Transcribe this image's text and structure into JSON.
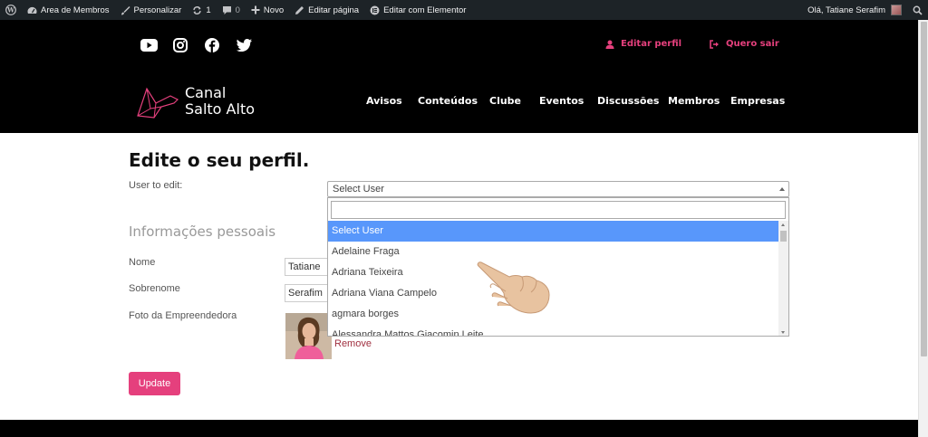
{
  "adminbar": {
    "site_name": "Area de Membros",
    "customize": "Personalizar",
    "updates_count": "1",
    "comments_count": "0",
    "new_label": "Novo",
    "edit_page": "Editar página",
    "edit_elementor": "Editar com Elementor",
    "greeting": "Olá, Tatiane Serafim"
  },
  "header": {
    "social_icons": [
      "youtube-icon",
      "instagram-icon",
      "facebook-icon",
      "twitter-icon"
    ],
    "edit_profile_link": "Editar perfil",
    "logout_link": "Quero sair",
    "logo_line1": "Canal",
    "logo_line2": "Salto Alto",
    "nav": [
      "Avisos",
      "Conteúdos",
      "Clube",
      "Eventos",
      "Discussões",
      "Membros",
      "Empresas"
    ],
    "accent_color": "#e5407d"
  },
  "main": {
    "page_title": "Edite o seu perfil.",
    "user_to_edit_label": "User to edit:",
    "select": {
      "value": "Select User",
      "options": [
        "Select User",
        "Adelaine Fraga",
        "Adriana Teixeira",
        "Adriana Viana Campelo",
        "agmara borges",
        "Alessandra Mattos Giacomin Leite"
      ],
      "highlighted_index": 0
    },
    "section_title": "Informações pessoais",
    "first_name_label": "Nome",
    "first_name_value": "Tatiane",
    "last_name_label": "Sobrenome",
    "last_name_value": "Serafim",
    "photo_label": "Foto da Empreendedora",
    "remove_label": "Remove",
    "update_button": "Update"
  }
}
